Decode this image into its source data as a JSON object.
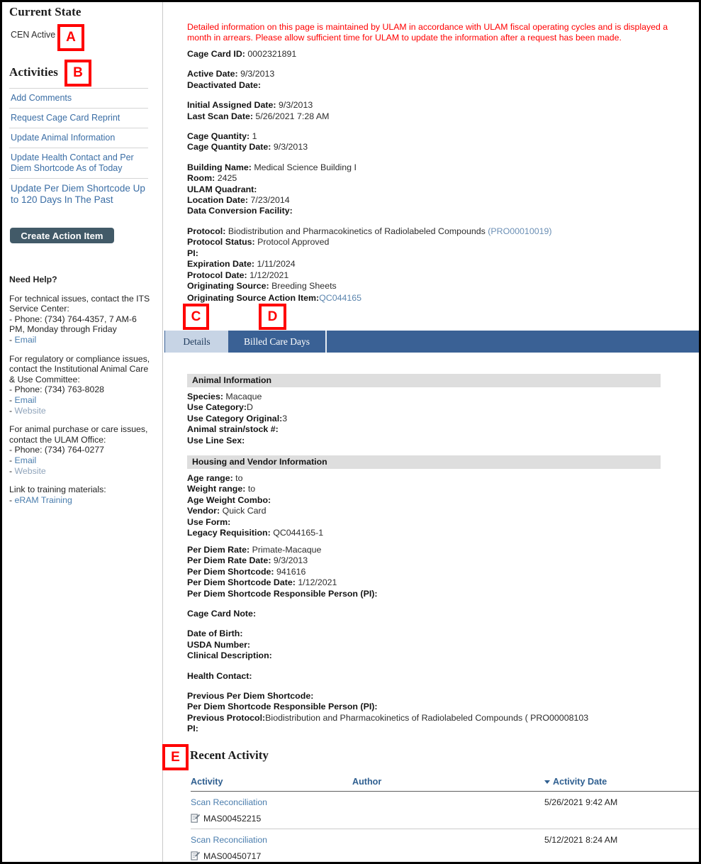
{
  "sidebar": {
    "current_state_heading": "Current State",
    "current_state_value": "CEN Active",
    "activities_heading": "Activities",
    "activities": [
      "Add Comments",
      "Request Cage Card Reprint",
      "Update Animal Information",
      "Update Health Contact and Per Diem Shortcode As of Today",
      "Update Per Diem Shortcode Up to 120 Days In The Past"
    ],
    "create_action_item_label": "Create Action Item",
    "help": {
      "title": "Need Help?",
      "para1_text": "For technical issues, contact the ITS Service Center:\n- Phone: (734) 764-4357, 7 AM-6 PM, Monday through Friday\n- ",
      "para1_link": "Email",
      "para2_text": "For regulatory or compliance issues, contact the Institutional Animal Care & Use Committee:\n- Phone: (734) 763-8028\n- ",
      "para2_link1": "Email",
      "para2_link2": "Website",
      "para3_text": "For animal purchase or care issues, contact the ULAM Office:\n- Phone: (734) 764-0277\n- ",
      "para3_link1": "Email",
      "para3_link2": "Website",
      "para4_text": "Link to training materials:\n- ",
      "para4_link": "eRAM Training"
    }
  },
  "main": {
    "alert": "Detailed information on this page is maintained by ULAM in accordance with ULAM fiscal operating cycles and is displayed a month in arrears. Please allow sufficient time for ULAM to update the information after a request has been made.",
    "fields": {
      "cage_card_id_label": "Cage Card ID:",
      "cage_card_id_value": "0002321891",
      "active_date_label": "Active Date:",
      "active_date_value": "9/3/2013",
      "deactivated_date_label": "Deactivated Date:",
      "deactivated_date_value": "",
      "initial_assigned_date_label": "Initial Assigned Date:",
      "initial_assigned_date_value": "9/3/2013",
      "last_scan_date_label": "Last Scan Date:",
      "last_scan_date_value": "5/26/2021 7:28 AM",
      "cage_quantity_label": "Cage Quantity:",
      "cage_quantity_value": "1",
      "cage_quantity_date_label": "Cage Quantity Date:",
      "cage_quantity_date_value": "9/3/2013",
      "building_name_label": "Building Name:",
      "building_name_value": "Medical Science Building I",
      "room_label": "Room:",
      "room_value": "2425",
      "ulam_quadrant_label": "ULAM Quadrant:",
      "ulam_quadrant_value": "",
      "location_date_label": "Location Date:",
      "location_date_value": "7/23/2014",
      "data_conversion_facility_label": "Data Conversion Facility:",
      "data_conversion_facility_value": "",
      "protocol_label": "Protocol:",
      "protocol_value": "Biodistribution and Pharmacokinetics of Radiolabeled Compounds",
      "protocol_id": "(PRO00010019)",
      "protocol_status_label": "Protocol Status:",
      "protocol_status_value": "Protocol Approved",
      "pi_label": "PI:",
      "pi_value": "",
      "expiration_date_label": "Expiration Date:",
      "expiration_date_value": "1/11/2024",
      "protocol_date_label": "Protocol Date:",
      "protocol_date_value": "1/12/2021",
      "originating_source_label": "Originating Source:",
      "originating_source_value": "Breeding Sheets",
      "originating_source_action_item_label": "Originating Source Action Item:",
      "originating_source_action_item_value": "QC044165"
    },
    "tabs": [
      {
        "label": "Details",
        "active": true
      },
      {
        "label": "Billed Care Days",
        "active": false
      }
    ],
    "sections": {
      "animal_information_heading": "Animal Information",
      "animal_fields": {
        "species_label": "Species:",
        "species_value": "Macaque",
        "use_category_label": "Use Category:",
        "use_category_value": "D",
        "use_category_original_label": "Use Category Original:",
        "use_category_original_value": "3",
        "animal_strain_label": "Animal strain/stock #:",
        "animal_strain_value": "",
        "use_line_sex_label": "Use Line Sex:",
        "use_line_sex_value": ""
      },
      "housing_heading": "Housing and Vendor Information",
      "housing_fields": {
        "age_range_label": "Age range:",
        "age_range_value": "to",
        "weight_range_label": "Weight range:",
        "weight_range_value": "to",
        "age_weight_combo_label": "Age Weight Combo:",
        "age_weight_combo_value": "",
        "vendor_label": "Vendor:",
        "vendor_value": "Quick Card",
        "use_form_label": "Use Form:",
        "use_form_value": "",
        "legacy_requisition_label": "Legacy Requisition:",
        "legacy_requisition_value": "QC044165-1"
      },
      "lower_fields": {
        "per_diem_rate_label": "Per Diem Rate:",
        "per_diem_rate_value": "Primate-Macaque",
        "per_diem_rate_date_label": "Per Diem Rate Date:",
        "per_diem_rate_date_value": "9/3/2013",
        "per_diem_shortcode_label": "Per Diem Shortcode:",
        "per_diem_shortcode_value": "941616",
        "per_diem_shortcode_date_label": "Per Diem Shortcode Date:",
        "per_diem_shortcode_date_value": "1/12/2021",
        "per_diem_shortcode_person_label": "Per Diem Shortcode Responsible Person (PI):",
        "per_diem_shortcode_person_value": "",
        "cage_card_note_label": "Cage Card Note:",
        "cage_card_note_value": "",
        "date_of_birth_label": "Date of Birth:",
        "date_of_birth_value": "",
        "usda_number_label": "USDA Number:",
        "usda_number_value": "",
        "clinical_description_label": "Clinical Description:",
        "clinical_description_value": "",
        "health_contact_label": "Health Contact:",
        "health_contact_value": "",
        "previous_per_diem_shortcode_label": "Previous Per Diem Shortcode:",
        "previous_per_diem_shortcode_value": "",
        "per_diem_shortcode_person2_label": "Per Diem Shortcode Responsible Person (PI):",
        "per_diem_shortcode_person2_value": "",
        "previous_protocol_label": "Previous Protocol:",
        "previous_protocol_value": "Biodistribution and Pharmacokinetics of Radiolabeled Compounds (  PRO00008103",
        "pi2_label": "PI:",
        "pi2_value": ""
      }
    },
    "recent_activity": {
      "title": "Recent Activity",
      "columns": {
        "activity": "Activity",
        "author": "Author",
        "activity_date": "Activity Date"
      },
      "sort_indicator": "descending",
      "rows": [
        {
          "activity": "Scan Reconciliation",
          "author": "",
          "date": "5/26/2021 9:42 AM",
          "doc_id": "MAS00452215"
        },
        {
          "activity": "Scan Reconciliation",
          "author": "",
          "date": "5/12/2021 8:24 AM",
          "doc_id": "MAS00450717"
        }
      ]
    }
  },
  "annotations": [
    {
      "id": "A",
      "label": "A"
    },
    {
      "id": "B",
      "label": "B"
    },
    {
      "id": "C",
      "label": "C"
    },
    {
      "id": "D",
      "label": "D"
    },
    {
      "id": "E",
      "label": "E"
    }
  ],
  "colors": {
    "alert_red": "#ff0000",
    "link_blue": "#4a7dad",
    "tab_active_bg": "#c7d4e5",
    "tab_inactive_bg": "#3a6195",
    "button_bg": "#425a68",
    "section_header_bg": "#dedede",
    "annotation_red": "#ff0000"
  }
}
